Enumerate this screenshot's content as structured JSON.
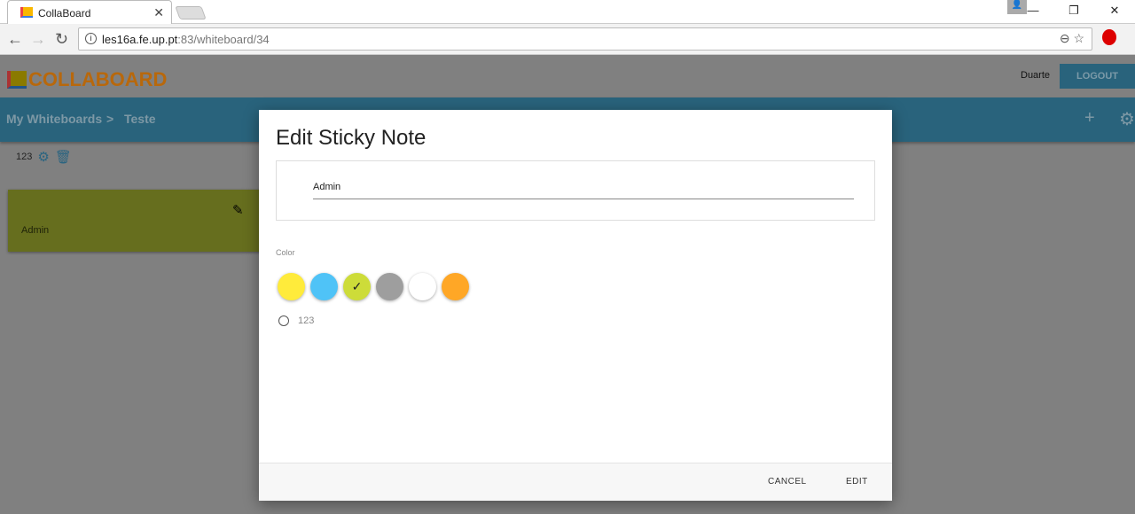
{
  "browser": {
    "tab_title": "CollaBoard",
    "url_host": "les16a.fe.up.pt",
    "url_path": ":83/whiteboard/34"
  },
  "app": {
    "logo": "COLLABOARD",
    "username": "Duarte",
    "logout": "LOGOUT"
  },
  "breadcrumb": {
    "root": "My Whiteboards",
    "separator": ">",
    "current": "Teste"
  },
  "tag": {
    "label": "123"
  },
  "note": {
    "text": "Admin",
    "color": "#cddc39"
  },
  "dialog": {
    "title": "Edit Sticky Note",
    "text_value": "Admin",
    "color_label": "Color",
    "colors": [
      {
        "hex": "#ffeb3b",
        "selected": false
      },
      {
        "hex": "#4fc3f7",
        "selected": false
      },
      {
        "hex": "#cddc39",
        "selected": true
      },
      {
        "hex": "#9e9e9e",
        "selected": false
      },
      {
        "hex": "#ffffff",
        "selected": false
      },
      {
        "hex": "#ffa726",
        "selected": false
      }
    ],
    "check": "✓",
    "tag_option": "123",
    "cancel": "CANCEL",
    "edit": "EDIT"
  }
}
